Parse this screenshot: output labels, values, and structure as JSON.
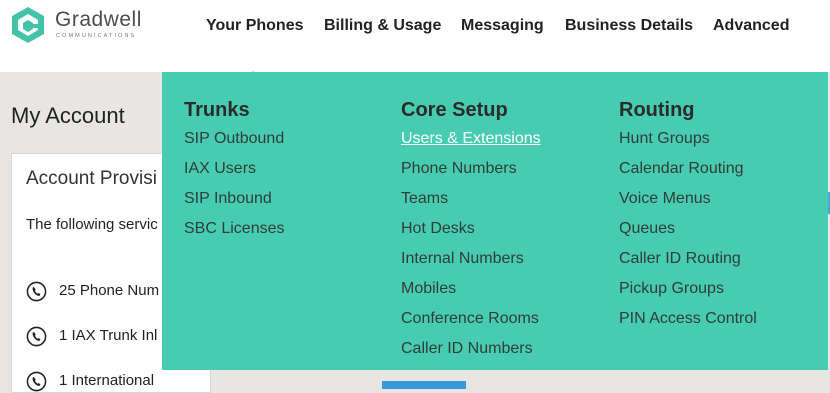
{
  "logo": {
    "name": "Gradwell",
    "subtitle": "COMMUNICATIONS"
  },
  "nav": [
    "Your Phones",
    "Billing & Usage",
    "Messaging",
    "Business Details",
    "Advanced"
  ],
  "page": {
    "title": "My Account",
    "card_title": "Account Provisi",
    "card_text": "The following servic",
    "services": [
      "25 Phone Num",
      "1 IAX Trunk Inl",
      "1 International"
    ]
  },
  "menu": {
    "columns": [
      {
        "title": "Trunks",
        "links": [
          "SIP Outbound",
          "IAX Users",
          "SIP Inbound",
          "SBC Licenses"
        ]
      },
      {
        "title": "Core Setup",
        "links": [
          "Users & Extensions",
          "Phone Numbers",
          "Teams",
          "Hot Desks",
          "Internal Numbers",
          "Mobiles",
          "Conference Rooms",
          "Caller ID Numbers"
        ]
      },
      {
        "title": "Routing",
        "links": [
          "Hunt Groups",
          "Calendar Routing",
          "Voice Menus",
          "Queues",
          "Caller ID Routing",
          "Pickup Groups",
          "PIN Access Control"
        ]
      }
    ],
    "active_link": "Users & Extensions"
  },
  "colors": {
    "accent": "#48ccb1",
    "logo": "#45c3a8",
    "link_blue": "#3a9ad9"
  },
  "icons": {
    "logo": "gradwell-hexagon-icon",
    "service": "phone-icon"
  }
}
